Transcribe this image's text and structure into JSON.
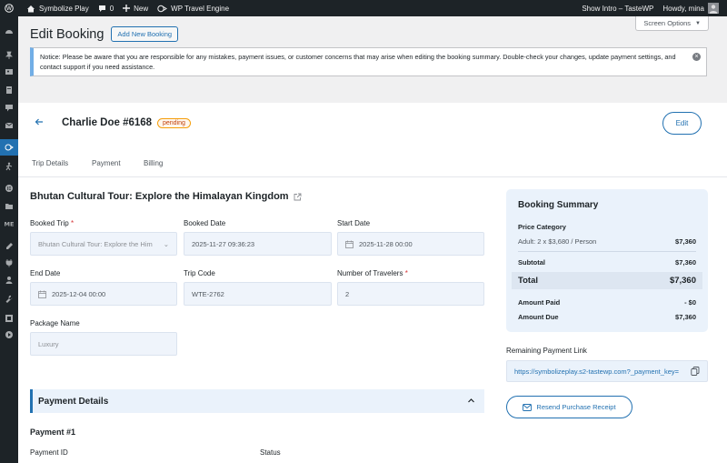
{
  "adminbar": {
    "site_name": "Symbolize Play",
    "comments_count": "0",
    "new_label": "New",
    "plugin_label": "WP Travel Engine",
    "show_intro": "Show Intro – TasteWP",
    "howdy": "Howdy, mina"
  },
  "sidebar": {
    "icons": [
      "dashboard-icon",
      "pin-icon",
      "media-icon",
      "pages-icon",
      "comments-icon",
      "mail-icon",
      "travel-icon",
      "hiker-icon",
      "elementor-icon",
      "folder-icon",
      "templates-icon",
      "appearance-icon",
      "plugins-icon",
      "users-icon",
      "tools-icon",
      "settings-icon",
      "play-icon"
    ],
    "active_index": 6
  },
  "header": {
    "screen_options": "Screen Options",
    "page_title": "Edit Booking",
    "add_new": "Add New Booking"
  },
  "notice": {
    "text": "Notice: Please be aware that you are responsible for any mistakes, payment issues, or customer concerns that may arise when editing the booking summary. Double-check your changes, update payment settings, and contact support if you need assistance."
  },
  "booking": {
    "name": "Charlie Doe #6168",
    "status": "pending",
    "edit_label": "Edit",
    "tabs": [
      "Trip Details",
      "Payment",
      "Billing"
    ],
    "trip_title": "Bhutan Cultural Tour: Explore the Himalayan Kingdom"
  },
  "fields": {
    "booked_trip": {
      "label": "Booked Trip",
      "value": "Bhutan Cultural Tour: Explore the Him"
    },
    "booked_date": {
      "label": "Booked Date",
      "value": "2025-11-27 09:36:23"
    },
    "start_date": {
      "label": "Start Date",
      "value": "2025-11-28 00:00"
    },
    "end_date": {
      "label": "End Date",
      "value": "2025-12-04 00:00"
    },
    "trip_code": {
      "label": "Trip Code",
      "value": "WTE-2762"
    },
    "travelers": {
      "label": "Number of Travelers",
      "value": "2"
    },
    "package": {
      "label": "Package Name",
      "value": "Luxury"
    }
  },
  "payment": {
    "section_title": "Payment Details",
    "payment_no": "Payment #1",
    "payment_id_label": "Payment ID",
    "status_label": "Status"
  },
  "summary": {
    "title": "Booking Summary",
    "price_category": "Price Category",
    "adult_line": "Adult: 2 x $3,680 / Person",
    "adult_amount": "$7,360",
    "subtotal_label": "Subtotal",
    "subtotal": "$7,360",
    "total_label": "Total",
    "total": "$7,360",
    "paid_label": "Amount Paid",
    "paid": "- $0",
    "due_label": "Amount Due",
    "due": "$7,360"
  },
  "remaining": {
    "label": "Remaining Payment Link",
    "url": "https://symbolizeplay.s2-tastewp.com?_payment_key=",
    "resend": "Resend Purchase Receipt"
  }
}
